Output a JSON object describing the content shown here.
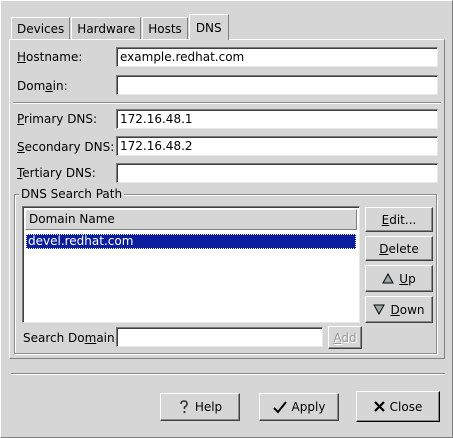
{
  "tabs": [
    {
      "label": "Devices"
    },
    {
      "label": "Hardware"
    },
    {
      "label": "Hosts"
    },
    {
      "label": "DNS",
      "active": true
    }
  ],
  "fields": {
    "hostname": {
      "label": "Hostname:",
      "value": "example.redhat.com"
    },
    "domain": {
      "label": "Domain:",
      "value": ""
    },
    "primary_dns": {
      "label": "Primary DNS:",
      "value": "172.16.48.1"
    },
    "secondary_dns": {
      "label": "Secondary DNS:",
      "value": "172.16.48.2"
    },
    "tertiary_dns": {
      "label": "Tertiary DNS:",
      "value": ""
    }
  },
  "search_path": {
    "title": "DNS Search Path",
    "column_header": "Domain Name",
    "rows": [
      "devel.redhat.com"
    ],
    "selected_row": 0,
    "search_domain_label": "Search Domain:",
    "search_domain_value": "",
    "add_label": "Add",
    "edit_label": "Edit...",
    "delete_label": "Delete",
    "up_label": "Up",
    "down_label": "Down"
  },
  "footer": {
    "help_label": "Help",
    "apply_label": "Apply",
    "close_label": "Close"
  },
  "colors": {
    "window_bg": "#d6d6d6",
    "selection_bg": "#0b1f9e"
  },
  "icons": {
    "help": "question-icon",
    "apply": "checkmark-icon",
    "close": "x-icon",
    "up": "up-triangle-icon",
    "down": "down-triangle-icon"
  }
}
